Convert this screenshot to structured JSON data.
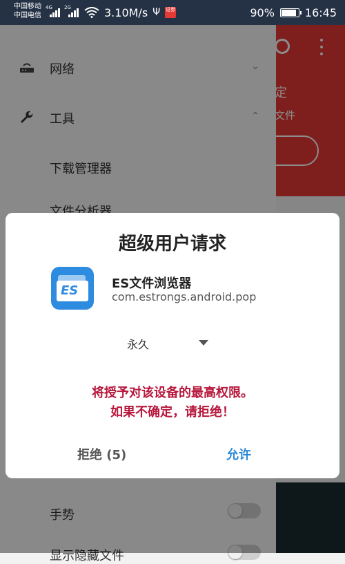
{
  "status_bar": {
    "carrier_1": "中国移动",
    "carrier_2": "中国电信",
    "network_1": "4G",
    "network_2": "2G",
    "speed": "3.10M/s",
    "notification_badge": "证券",
    "battery": "90%",
    "battery_level": 0.9,
    "time": "16:45"
  },
  "background_app": {
    "header_color": "#e53935",
    "header_text_1": "定",
    "header_text_2": "文件"
  },
  "drawer": {
    "items": [
      {
        "label": "网络",
        "icon": "router-icon",
        "expanded": false
      },
      {
        "label": "工具",
        "icon": "wrench-icon",
        "expanded": true
      }
    ],
    "tool_items": [
      "下载管理器",
      "文件分析器"
    ],
    "settings": [
      {
        "label": "手势",
        "enabled": false
      },
      {
        "label": "显示隐藏文件",
        "enabled": false
      }
    ]
  },
  "dialog": {
    "title": "超级用户请求",
    "app_name": "ES文件浏览器",
    "package": "com.estrongs.android.pop",
    "icon_text": "ES",
    "duration": "永久",
    "warning_line_1": "将授予对该设备的最高权限。",
    "warning_line_2": "如果不确定，请拒绝！",
    "deny_label": "拒绝 (5)",
    "allow_label": "允许",
    "warning_color": "#b7173c",
    "accent_color": "#2b89d6"
  }
}
